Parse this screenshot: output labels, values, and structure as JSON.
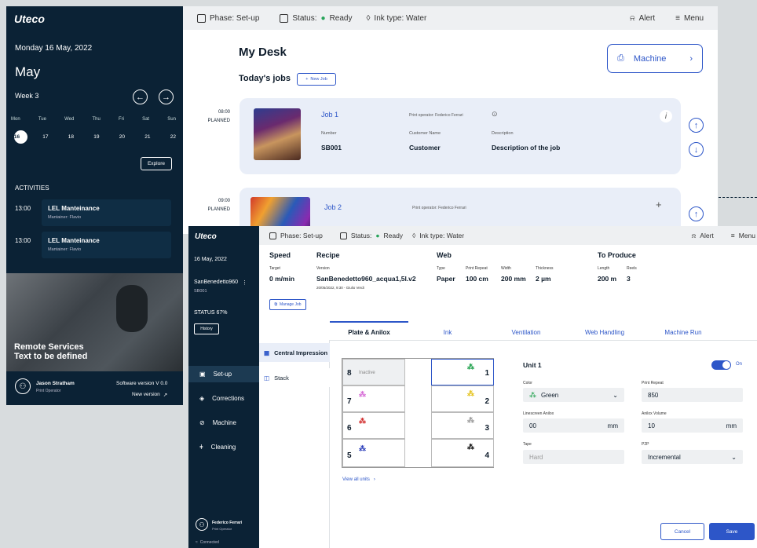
{
  "back_sidebar": {
    "logo": "Uteco",
    "date": "Monday 16 May, 2022",
    "month": "May",
    "week": "Week 3",
    "days": [
      "Mon",
      "Tue",
      "Wed",
      "Thu",
      "Fri",
      "Sat",
      "Sun"
    ],
    "dates": [
      "16",
      "17",
      "18",
      "19",
      "20",
      "21",
      "22"
    ],
    "explore": "Explore",
    "activities_title": "ACTIVITIES",
    "activities": [
      {
        "time": "13:00",
        "title": "LEL Manteinance",
        "sub": "Mantainer: Flavio"
      },
      {
        "time": "13:00",
        "title": "LEL Manteinance",
        "sub": "Mantainer: Flavio"
      }
    ],
    "remote_title": "Remote Services",
    "remote_sub": "Text to be defined",
    "user_name": "Jason Stratham",
    "user_role": "Print Operator",
    "software_version": "Software version V 0.0",
    "new_version": "New version"
  },
  "back_header": {
    "phase": "Phase: Set-up",
    "status": "Status:",
    "status_value": "Ready",
    "ink": "Ink type: Water",
    "alert": "Alert",
    "menu": "Menu"
  },
  "back_main": {
    "title": "My Desk",
    "machine": "Machine",
    "todays_jobs": "Today's jobs",
    "new_job": "New Job",
    "jobs": [
      {
        "time": "08:00",
        "state": "PLANNED",
        "name": "Job 1",
        "operator": "Print operator: Federico Ferrari",
        "number_label": "Number",
        "number": "SB001",
        "customer_label": "Customer Name",
        "customer": "Customer",
        "desc_label": "Description",
        "desc": "Description of the job"
      },
      {
        "time": "09:00",
        "state": "PLANNED",
        "name": "Job 2",
        "operator": "Print operator: Federico Ferrari"
      }
    ]
  },
  "front_sidebar": {
    "logo": "Uteco",
    "date": "16 May, 2022",
    "job": "SanBenedetto960",
    "job_code": "SB001",
    "status": "STATUS 67%",
    "history": "History",
    "nav": [
      "Set-up",
      "Corrections",
      "Machine",
      "Cleaning"
    ],
    "user_name": "Federico Ferrari",
    "user_role": "Print Operator",
    "connected": "Connected"
  },
  "front_header": {
    "phase": "Phase: Set-up",
    "status": "Status:",
    "status_value": "Ready",
    "ink": "Ink type: Water",
    "alert": "Alert",
    "menu": "Menu"
  },
  "front_info": {
    "speed_title": "Speed",
    "speed_label": "Target",
    "speed": "0 m/min",
    "recipe_title": "Recipe",
    "recipe_label": "Version",
    "recipe": "SanBenedetto960_acqua1,5l.v2",
    "recipe_date": "20/05/2022, 9:30 - Giulio Verdi",
    "web_title": "Web",
    "web_labels": [
      "Type",
      "Print Repeat",
      "Width",
      "Thickness"
    ],
    "web_values": [
      "Paper",
      "100 cm",
      "200 mm",
      "2 µm"
    ],
    "produce_title": "To Produce",
    "produce_labels": [
      "Length",
      "Reels"
    ],
    "produce_values": [
      "200 m",
      "3"
    ],
    "manage_job": "Manage Job"
  },
  "tabs": [
    "Plate & Anilox",
    "Ink",
    "Ventilation",
    "Web Handling",
    "Machine Run"
  ],
  "left_menu": [
    "Central Impression",
    "Stack"
  ],
  "units": {
    "left": [
      {
        "n": "8",
        "label": "Inactive"
      },
      {
        "n": "7"
      },
      {
        "n": "6"
      },
      {
        "n": "5"
      }
    ],
    "right": [
      "1",
      "2",
      "3",
      "4"
    ],
    "view_all": "View all units"
  },
  "unit_form": {
    "title": "Unit 1",
    "toggle": "On",
    "color_label": "Color",
    "color": "Green",
    "print_repeat_label": "Print Repeat",
    "print_repeat": "850",
    "linescreen_label": "Linescreen Anilox",
    "linescreen": "00",
    "linescreen_unit": "mm",
    "anilox_label": "Anilox Volume",
    "anilox": "10",
    "anilox_unit": "mm",
    "tape_label": "Tape",
    "tape": "Hard",
    "p2p_label": "P2P",
    "p2p": "Incremental",
    "cancel": "Cancel",
    "save": "Save"
  }
}
